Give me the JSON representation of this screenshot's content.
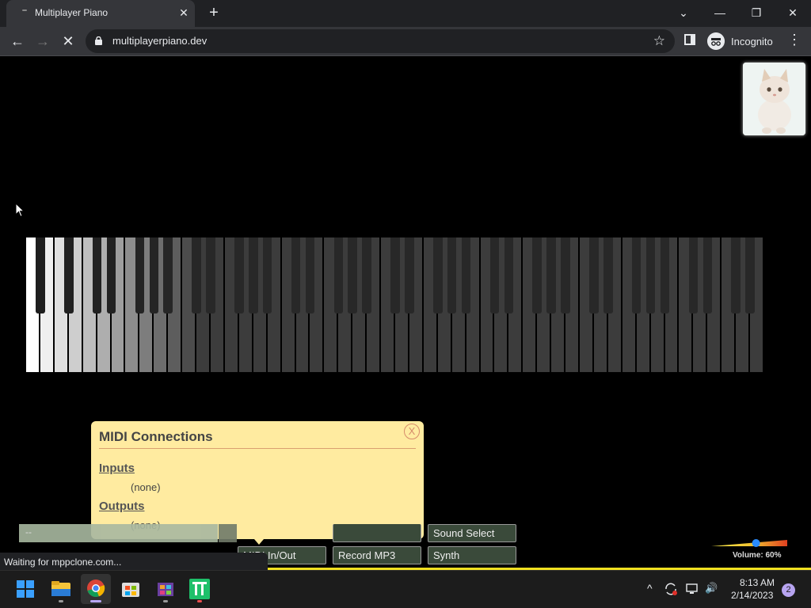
{
  "browser": {
    "tab_title": "Multiplayer Piano",
    "tab_close": "✕",
    "new_tab": "+",
    "url": "multiplayerpiano.dev",
    "incognito_label": "Incognito",
    "window": {
      "dropdown": "⌄",
      "minimize": "—",
      "restore": "❐",
      "close": "✕"
    },
    "nav": {
      "back": "←",
      "forward": "→",
      "stop": "✕",
      "star": "☆",
      "menu": "⋮"
    }
  },
  "midi_panel": {
    "title": "MIDI Connections",
    "close_label": "X",
    "inputs_heading": "Inputs",
    "inputs_value": "(none)",
    "outputs_heading": "Outputs",
    "outputs_value": "(none)"
  },
  "chat": {
    "placeholder_text": "--"
  },
  "buttons": {
    "sound_select": "Sound Select",
    "midi_in_out": "MIDI In/Out",
    "record_mp3": "Record MP3",
    "synth": "Synth"
  },
  "volume": {
    "label": "Volume: 60%",
    "value": 0.6
  },
  "status": {
    "text": "Waiting for mppclone.com..."
  },
  "taskbar": {
    "apps": [
      "windows-start-icon",
      "file-explorer-icon",
      "chrome-icon",
      "microsoft-store-icon",
      "store-app-icon",
      "text-app-icon"
    ],
    "tray": {
      "chevron": "^",
      "speaker": "🔊"
    },
    "time": "8:13 AM",
    "date": "2/14/2023",
    "notifications": "2"
  },
  "colors": {
    "panel_bg": "#ffeba0",
    "accent": "#f0e020"
  }
}
